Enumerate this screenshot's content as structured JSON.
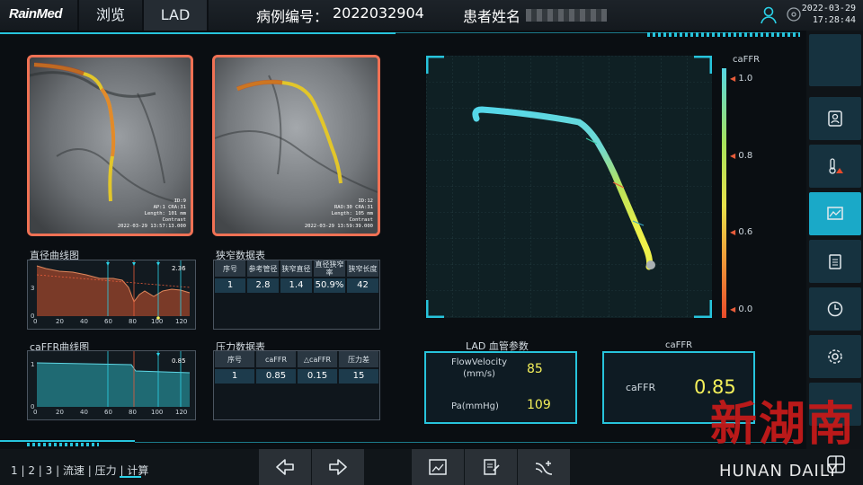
{
  "app": {
    "logo": "RainMed"
  },
  "tabs": [
    {
      "label": "浏览"
    },
    {
      "label": "LAD"
    }
  ],
  "header": {
    "case_label": "病例编号：",
    "case_id": "2022032904",
    "patient_label": "患者姓名",
    "date": "2022-03-29",
    "time": "17:28:44"
  },
  "images": [
    {
      "id": "ID:9",
      "angle": "AP:1 CRA:31",
      "length": "Length: 101 mm",
      "mode": "Contrast",
      "timestamp": "2022-03-29 13:57:13.000"
    },
    {
      "id": "ID:12",
      "angle": "RAO:30 CRA:31",
      "length": "Length: 105 mm",
      "mode": "Contrast",
      "timestamp": "2022-03-29 13:59:39.000"
    }
  ],
  "diameter_chart": {
    "title": "直径曲线图",
    "value_label": "2.36",
    "y_ticks": [
      "3",
      "0"
    ],
    "x_ticks": [
      "0",
      "20",
      "40",
      "60",
      "80",
      "100",
      "120"
    ]
  },
  "caffr_chart": {
    "title": "caFFR曲线图",
    "value_label": "0.85",
    "y_ticks": [
      "1",
      "0"
    ],
    "x_ticks": [
      "0",
      "20",
      "40",
      "60",
      "80",
      "100",
      "120"
    ]
  },
  "stenosis_table": {
    "title": "狭窄数据表",
    "headers": [
      "序号",
      "参考管径",
      "狭窄直径",
      "直径狭窄率",
      "狭窄长度"
    ],
    "rows": [
      [
        "1",
        "2.8",
        "1.4",
        "50.9%",
        "42"
      ]
    ]
  },
  "pressure_table": {
    "title": "压力数据表",
    "headers": [
      "序号",
      "caFFR",
      "△caFFR",
      "压力差"
    ],
    "rows": [
      [
        "1",
        "0.85",
        "0.15",
        "15"
      ]
    ]
  },
  "colorbar": {
    "title": "caFFR",
    "ticks": [
      "1.0",
      "0.8",
      "0.6",
      "0.0"
    ]
  },
  "vessel_params": {
    "title": "LAD  血管参数",
    "flow_label": "FlowVelocity\n(mm/s)",
    "flow_value": "85",
    "pa_label": "Pa(mmHg)",
    "pa_value": "109"
  },
  "caffr_result": {
    "title": "caFFR",
    "label": "caFFR",
    "value": "0.85"
  },
  "bottom_nav": {
    "step1": "1",
    "step2": "2",
    "step3": "3",
    "s1": "流速",
    "s2": "压力",
    "s3": "计算"
  },
  "watermark": {
    "cn": "新湖南",
    "en": "HUNAN DAILY"
  },
  "colors": {
    "accent": "#27c4dc",
    "orange": "#f07154",
    "value": "#f4f05a"
  }
}
